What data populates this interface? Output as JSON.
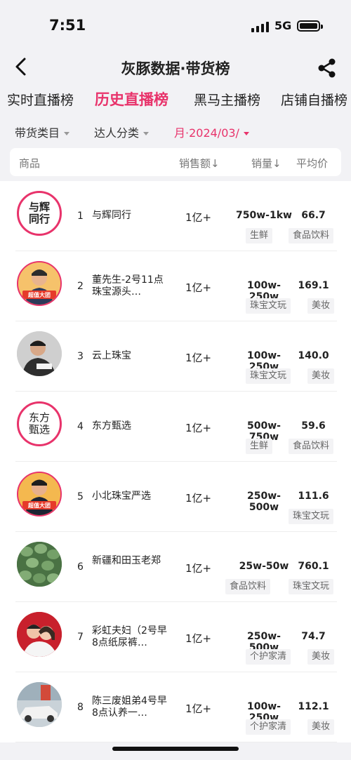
{
  "status_bar": {
    "time": "7:51",
    "network": "5G"
  },
  "nav": {
    "title": "灰豚数据·带货榜"
  },
  "tabs": [
    "实时直播榜",
    "历史直播榜",
    "黑马主播榜",
    "店铺自播榜"
  ],
  "active_tab": "历史直播榜",
  "filters": {
    "category": "带货类目",
    "talent": "达人分类",
    "month": "月·2024/03/"
  },
  "table_header": {
    "product": "商品",
    "sales_amount": "销售额",
    "sales_volume": "销量",
    "avg_price": "平均价"
  },
  "rows": [
    {
      "rank": "1",
      "name": "与辉同行",
      "sales": "1亿+",
      "volume": "750w-1kw",
      "price": "66.7",
      "tags": [
        "生鲜",
        "食品饮料"
      ]
    },
    {
      "rank": "2",
      "name": "董先生-2号11点珠宝源头…",
      "sales": "1亿+",
      "volume": "100w-250w",
      "price": "169.1",
      "tags": [
        "珠宝文玩",
        "美妆"
      ]
    },
    {
      "rank": "3",
      "name": "云上珠宝",
      "sales": "1亿+",
      "volume": "100w-250w",
      "price": "140.0",
      "tags": [
        "珠宝文玩",
        "美妆"
      ]
    },
    {
      "rank": "4",
      "name": "东方甄选",
      "sales": "1亿+",
      "volume": "500w-750w",
      "price": "59.6",
      "tags": [
        "生鲜",
        "食品饮料"
      ]
    },
    {
      "rank": "5",
      "name": "小北珠宝严选",
      "sales": "1亿+",
      "volume": "250w-500w",
      "price": "111.6",
      "tags": [
        "珠宝文玩"
      ]
    },
    {
      "rank": "6",
      "name": "新疆和田玉老郑",
      "sales": "1亿+",
      "volume": "25w-50w",
      "price": "760.1",
      "tags": [
        "食品饮料",
        "珠宝文玩"
      ]
    },
    {
      "rank": "7",
      "name": "彩虹夫妇（2号早8点纸尿裤…",
      "sales": "1亿+",
      "volume": "250w-500w",
      "price": "74.7",
      "tags": [
        "个护家清",
        "美妆"
      ]
    },
    {
      "rank": "8",
      "name": "陈三废姐弟4号早8点认养一…",
      "sales": "1亿+",
      "volume": "100w-250w",
      "price": "112.1",
      "tags": [
        "个护家清",
        "美妆"
      ]
    }
  ],
  "avatar_text": {
    "r1": "与辉同行",
    "r4": "东方甄选",
    "badge": "超值大团"
  },
  "colors": {
    "accent": "#e8336b",
    "background": "#f2f2f5"
  }
}
